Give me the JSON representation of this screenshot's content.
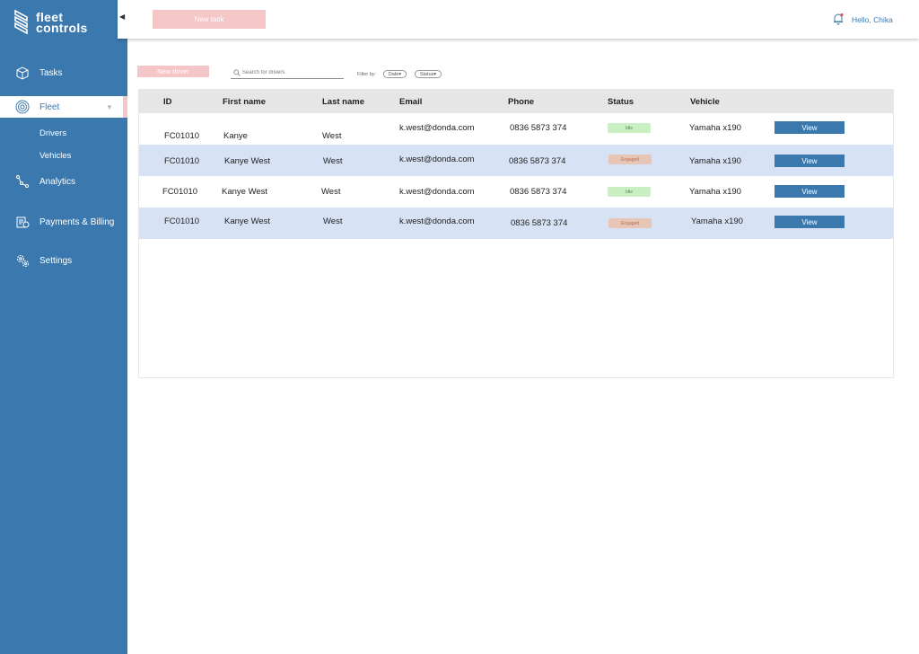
{
  "brand": {
    "line1": "fleet",
    "line2": "controls"
  },
  "sidebar": {
    "items": [
      {
        "label": "Tasks",
        "icon": "box-icon"
      },
      {
        "label": "Fleet",
        "icon": "fingerprint-icon",
        "active": true
      },
      {
        "label": "Analytics",
        "icon": "analytics-icon"
      },
      {
        "label": "Payments & Billing",
        "icon": "billing-icon"
      },
      {
        "label": "Settings",
        "icon": "gear-icon"
      }
    ],
    "sub_items": [
      "Drivers",
      "Vehicles"
    ]
  },
  "topbar": {
    "new_task_label": "New task",
    "greeting": "Hello, Chika"
  },
  "toolbar": {
    "new_driver_label": "New driver",
    "search_placeholder": "Search for drivers",
    "filter_label": "Filter by:",
    "filters": [
      "Date",
      "Status"
    ]
  },
  "table": {
    "columns": [
      "ID",
      "First name",
      "Last name",
      "Email",
      "Phone",
      "Status",
      "Vehicle"
    ],
    "rows": [
      {
        "id": "FC01010",
        "first": "Kanye",
        "last": "West",
        "email": "k.west@donda.com",
        "phone": "0836 5873 374",
        "status": "Idle",
        "vehicle": "Yamaha x190",
        "action": "View"
      },
      {
        "id": "FC01010",
        "first": "Kanye West",
        "last": "West",
        "email": "k.west@donda.com",
        "phone": "0836 5873 374",
        "status": "Engaged",
        "vehicle": "Yamaha x190",
        "action": "View"
      },
      {
        "id": "FC01010",
        "first": "Kanye West",
        "last": "West",
        "email": "k.west@donda.com",
        "phone": "0836 5873 374",
        "status": "Idle",
        "vehicle": "Yamaha x190",
        "action": "View"
      },
      {
        "id": "FC01010",
        "first": "Kanye West",
        "last": "West",
        "email": "k.west@donda.com",
        "phone": "0836 5873 374",
        "status": "Engaged",
        "vehicle": "Yamaha x190",
        "action": "View"
      }
    ]
  },
  "colors": {
    "primary": "#3b78ad",
    "accent_pink": "#f4c6c8",
    "row_alt": "#d7e2f4",
    "idle_bg": "#c9efc3",
    "engaged_bg": "#e7c6b7"
  }
}
